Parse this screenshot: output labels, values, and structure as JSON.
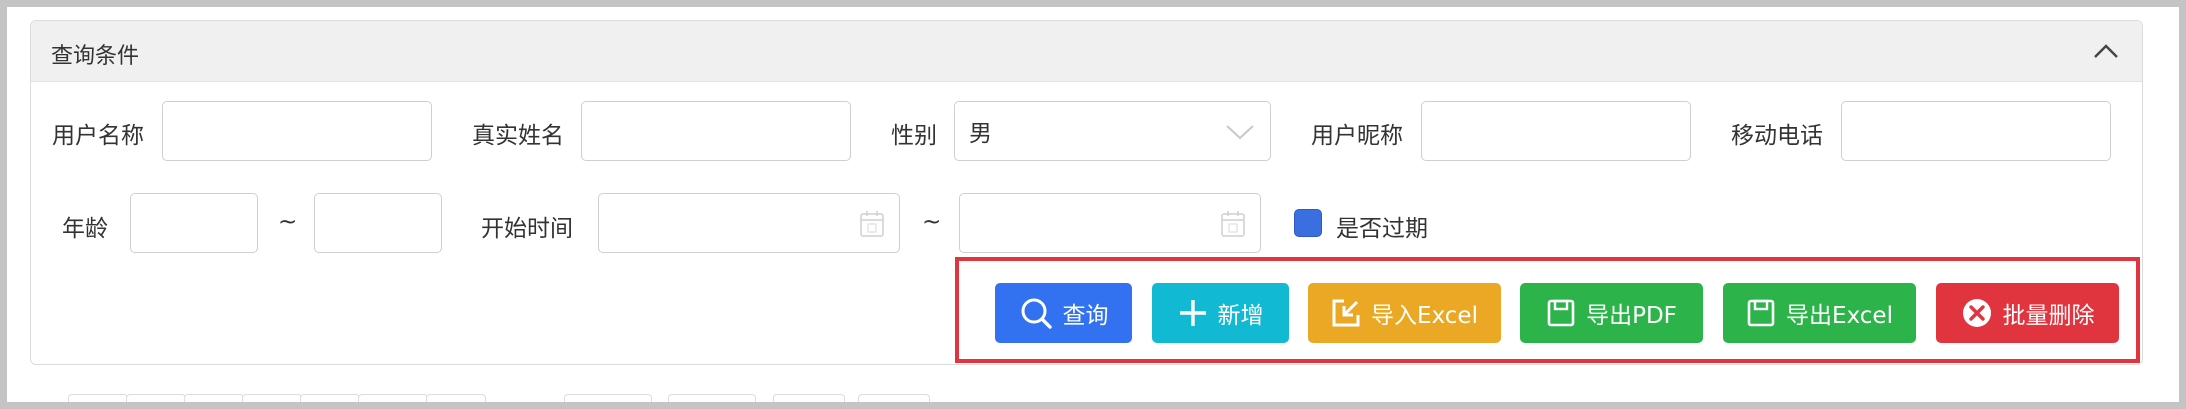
{
  "panel": {
    "title": "查询条件"
  },
  "form": {
    "username_label": "用户名称",
    "username_value": "",
    "realname_label": "真实姓名",
    "realname_value": "",
    "gender_label": "性别",
    "gender_value": "男",
    "nickname_label": "用户昵称",
    "nickname_value": "",
    "mobile_label": "移动电话",
    "mobile_value": "",
    "age_label": "年龄",
    "age_from": "",
    "age_to": "",
    "range_sep": "~",
    "start_time_label": "开始时间",
    "start_time_from": "",
    "start_time_to": "",
    "expired_label": "是否过期",
    "expired_checked": true
  },
  "buttons": {
    "query": "查询",
    "add": "新增",
    "import_excel": "导入Excel",
    "export_pdf": "导出PDF",
    "export_excel": "导出Excel",
    "batch_delete": "批量删除"
  },
  "colors": {
    "query": "#3271f0",
    "add": "#11b9d3",
    "import": "#eaa824",
    "export": "#2cb44a",
    "delete": "#e0343f",
    "highlight_border": "#e0343f",
    "checkbox": "#3b6fe0"
  },
  "icons": {
    "collapse": "chevron-up-icon",
    "gender_select": "chevron-down-icon",
    "date_picker": "calendar-icon",
    "query": "search-icon",
    "add": "plus-icon",
    "import": "import-icon",
    "export": "save-icon",
    "delete": "close-circle-icon"
  }
}
